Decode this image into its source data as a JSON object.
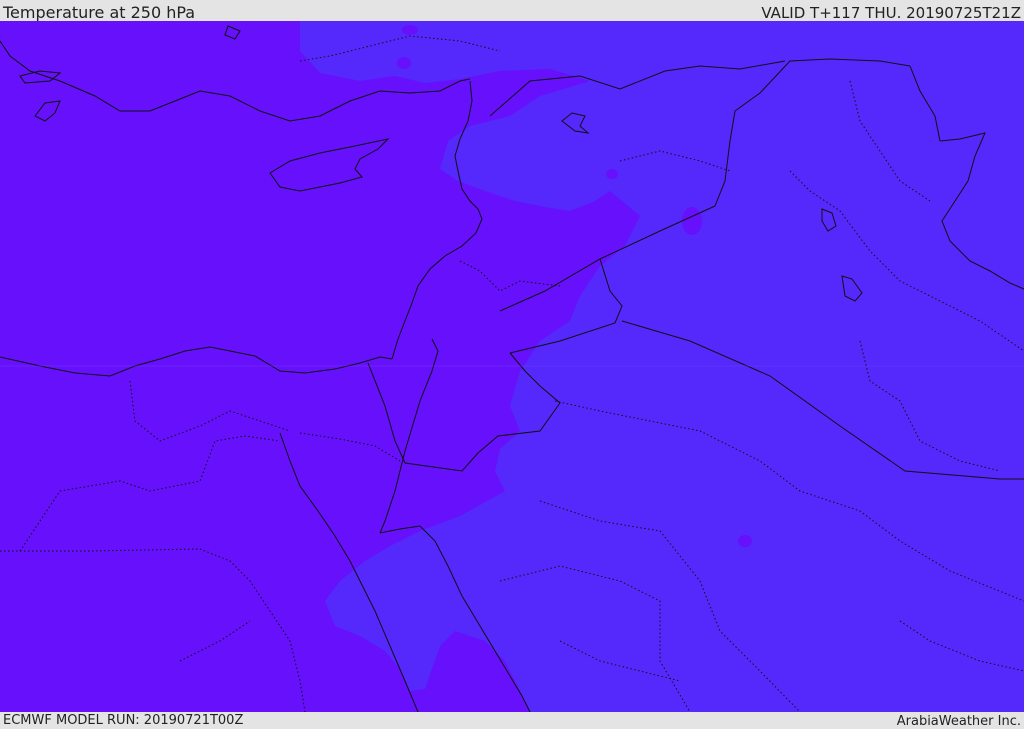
{
  "header": {
    "title": "Temperature at 250 hPa",
    "valid": "VALID T+117 THU. 20190725T21Z"
  },
  "footer": {
    "model_run": "ECMWF MODEL RUN: 20190721T00Z",
    "credit": "ArabiaWeather Inc."
  },
  "map": {
    "field": "temperature-250hPa",
    "colors": {
      "cold_violet": "#6610fb",
      "warm_indigo": "#5528fc",
      "background": "#e4e4e4",
      "border": "#111111"
    }
  }
}
